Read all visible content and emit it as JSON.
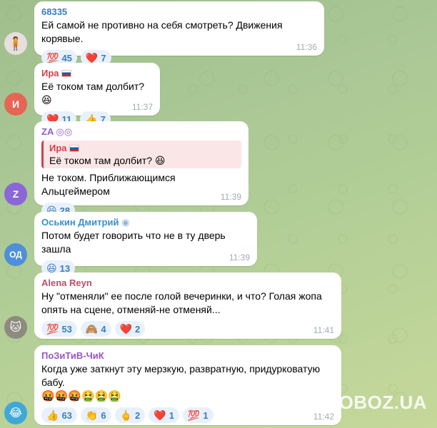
{
  "colors": {
    "reaction_text": "#3a7cc2",
    "reaction_bg": "#e8f1fb",
    "reply_accent": "#d33f49"
  },
  "messages": [
    {
      "sender": "68335",
      "sender_color": "#3a7cc2",
      "avatar_text": "",
      "avatar_color": "#e8dede",
      "text": "Ей самой не противно на себя смотреть? Движения корявые.",
      "time": "11:36",
      "reactions": [
        {
          "emoji": "💯",
          "count": "45"
        },
        {
          "emoji": "❤️",
          "count": "7"
        }
      ]
    },
    {
      "sender": "Ира",
      "sender_color": "#d33f49",
      "avatar_text": "И",
      "avatar_color": "#e66554",
      "text": "Её током там долбит? 😆",
      "time": "11:37",
      "reactions": [
        {
          "emoji": "❤️",
          "count": "11"
        },
        {
          "emoji": "👍",
          "count": "7"
        }
      ]
    },
    {
      "sender": "ZA",
      "sender_color": "#8a5fc8",
      "avatar_text": "Z",
      "avatar_color": "#8a67d6",
      "reply_name": "Ира",
      "reply_text": "Её током там долбит? 😆",
      "text": "Не током. Приближающимся Альцгеймером",
      "time": "11:39",
      "reactions": [
        {
          "emoji": "😆",
          "count": "28"
        }
      ]
    },
    {
      "sender": "Оськин Дмитрий",
      "sender_color": "#3a8fc8",
      "avatar_text": "ОД",
      "avatar_color": "#4f8fd9",
      "text": "Потом будет говорить что не в ту дверь зашла",
      "time": "11:39",
      "reactions": [
        {
          "emoji": "😆",
          "count": "13"
        }
      ]
    },
    {
      "sender": "Alena Reyn",
      "sender_color": "#b5506a",
      "avatar_text": "",
      "avatar_color": "#8d8a80",
      "text_lines": [
        "Ну \"отменяли\" ее после голой вечеринки, и что? Голая жопа",
        "опять на сцене, отменяй-не отменяй..."
      ],
      "time": "11:41",
      "reactions": [
        {
          "emoji": "💯",
          "count": "53"
        },
        {
          "emoji": "🙈",
          "count": "4"
        },
        {
          "emoji": "❤️",
          "count": "2"
        }
      ]
    },
    {
      "sender": "ПоЗиТиВ-ЧиК",
      "sender_color": "#9a55c2",
      "avatar_text": "",
      "avatar_color": "#3fa8d8",
      "text_lines": [
        "Когда уже заткнут эту мерзкую, развратную, придурковатую",
        "бабу."
      ],
      "emoji_line": "🤬🤬🤬🤮🤮🤮",
      "time": "11:42",
      "reactions": [
        {
          "emoji": "👍",
          "count": "63"
        },
        {
          "emoji": "👏",
          "count": "6"
        },
        {
          "emoji": "🖕",
          "count": "2"
        },
        {
          "emoji": "❤️",
          "count": "1"
        },
        {
          "emoji": "💯",
          "count": "1"
        }
      ]
    }
  ],
  "watermark": {
    "text": "OBOZ.UA"
  }
}
